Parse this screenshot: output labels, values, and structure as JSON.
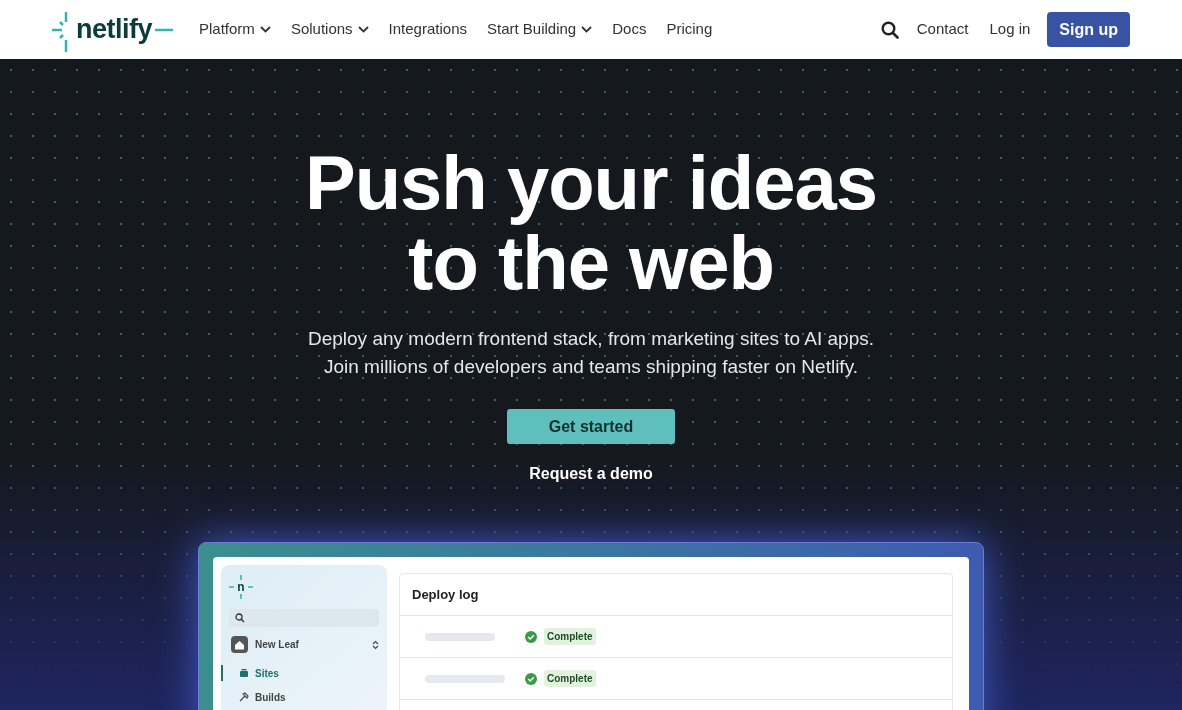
{
  "header": {
    "logo": "netlify",
    "nav": [
      {
        "label": "Platform",
        "has_menu": true
      },
      {
        "label": "Solutions",
        "has_menu": true
      },
      {
        "label": "Integrations",
        "has_menu": false
      },
      {
        "label": "Start Building",
        "has_menu": true
      },
      {
        "label": "Docs",
        "has_menu": false
      },
      {
        "label": "Pricing",
        "has_menu": false
      }
    ],
    "links": [
      "Contact",
      "Log in"
    ],
    "signup": "Sign up"
  },
  "hero": {
    "title_lines": [
      "Push your ideas",
      "to the web"
    ],
    "subtitle_lines": [
      "Deploy any modern frontend stack, from marketing sites to AI apps.",
      "Join millions of developers and teams shipping faster on Netlify."
    ],
    "primary_button": "Get started",
    "secondary_link": "Request a demo"
  },
  "dashboard": {
    "logo_letter": "n",
    "team": "New Leaf",
    "sidebar": {
      "items": [
        {
          "label": "Sites",
          "kind": "stack",
          "selected": true
        },
        {
          "label": "Builds",
          "kind": "hammer",
          "selected": false
        }
      ]
    },
    "deploy_log": {
      "title": "Deploy log",
      "rows": [
        {
          "status": "Complete"
        },
        {
          "status": "Complete"
        }
      ]
    }
  }
}
